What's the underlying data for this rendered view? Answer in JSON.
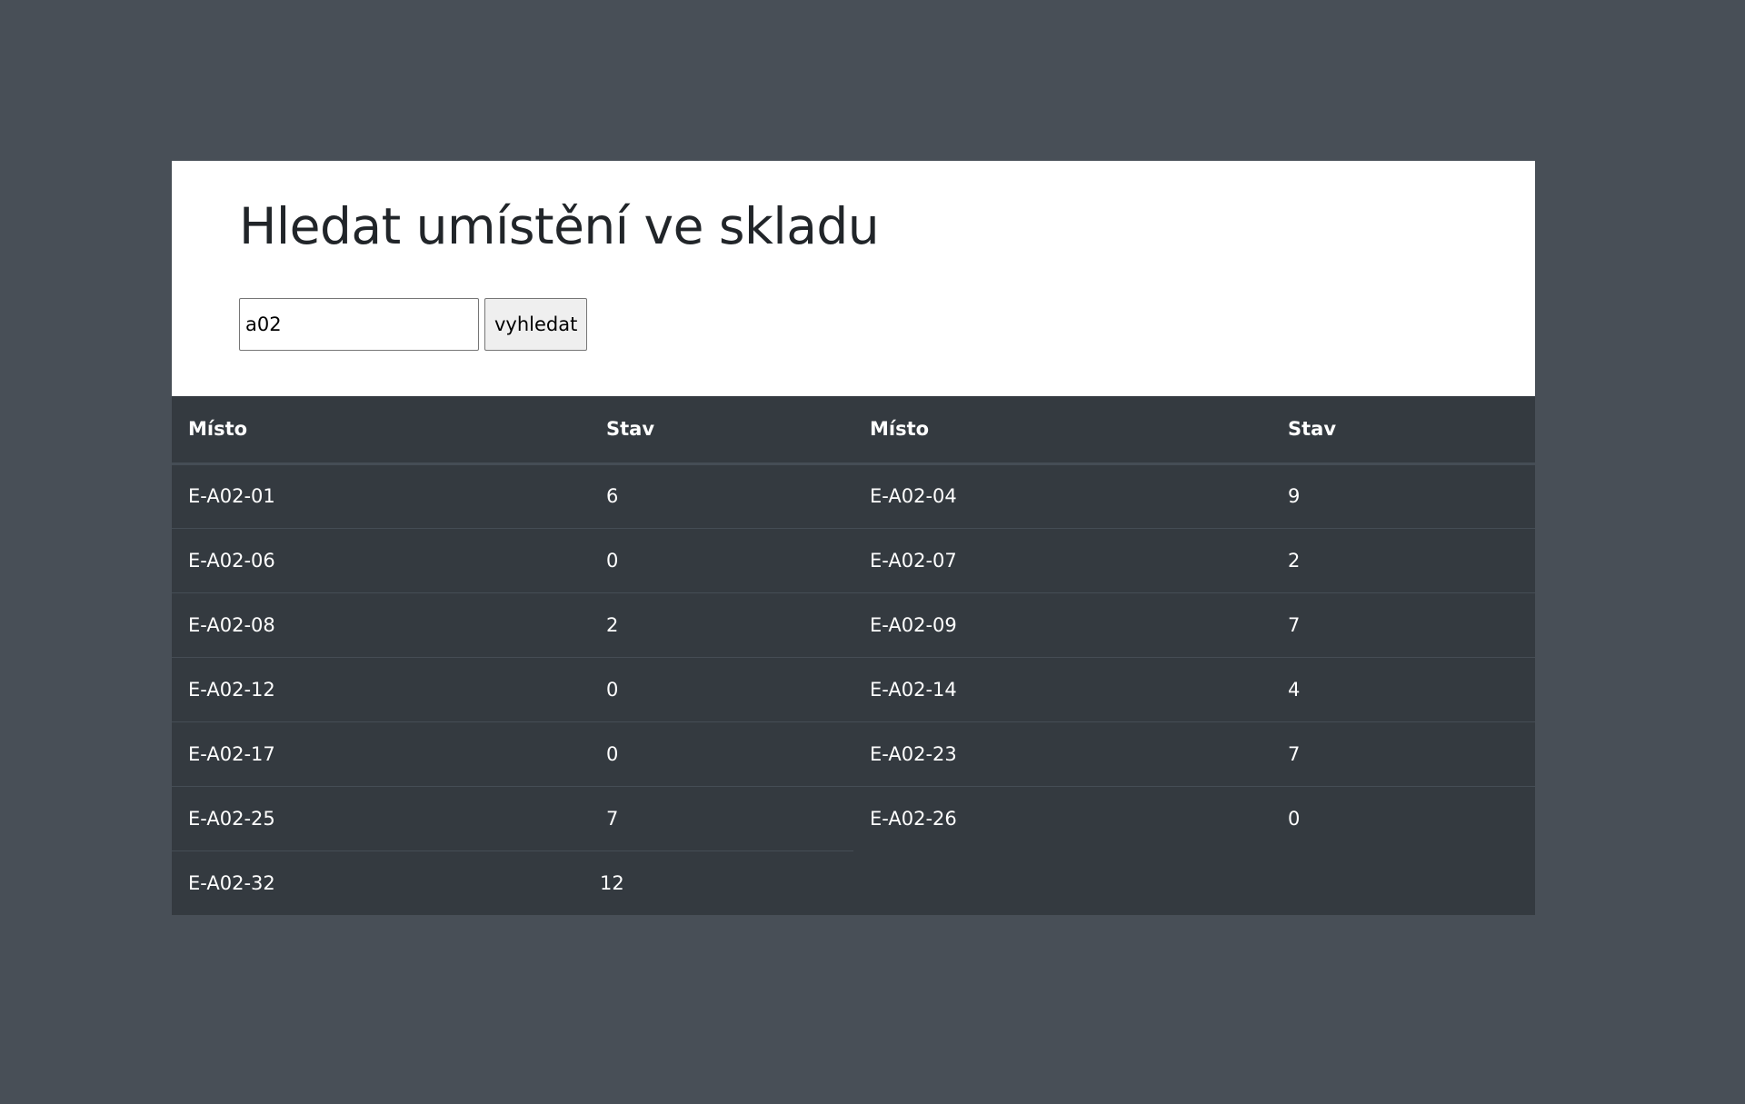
{
  "page": {
    "title": "Hledat umístění ve skladu"
  },
  "search": {
    "value": "a02",
    "button_label": "vyhledat"
  },
  "table": {
    "headers": {
      "place": "Místo",
      "state": "Stav"
    },
    "left_rows": [
      {
        "place": "E-A02-01",
        "state": "6"
      },
      {
        "place": "E-A02-06",
        "state": "0"
      },
      {
        "place": "E-A02-08",
        "state": "2"
      },
      {
        "place": "E-A02-12",
        "state": "0"
      },
      {
        "place": "E-A02-17",
        "state": "0"
      },
      {
        "place": "E-A02-25",
        "state": "7"
      },
      {
        "place": "E-A02-32",
        "state": "12"
      }
    ],
    "right_rows": [
      {
        "place": "E-A02-04",
        "state": "9"
      },
      {
        "place": "E-A02-07",
        "state": "2"
      },
      {
        "place": "E-A02-09",
        "state": "7"
      },
      {
        "place": "E-A02-14",
        "state": "4"
      },
      {
        "place": "E-A02-23",
        "state": "7"
      },
      {
        "place": "E-A02-26",
        "state": "0"
      }
    ]
  },
  "colors": {
    "background": "#484f57",
    "table_bg": "#343a40",
    "header_bg": "#ffffff"
  }
}
